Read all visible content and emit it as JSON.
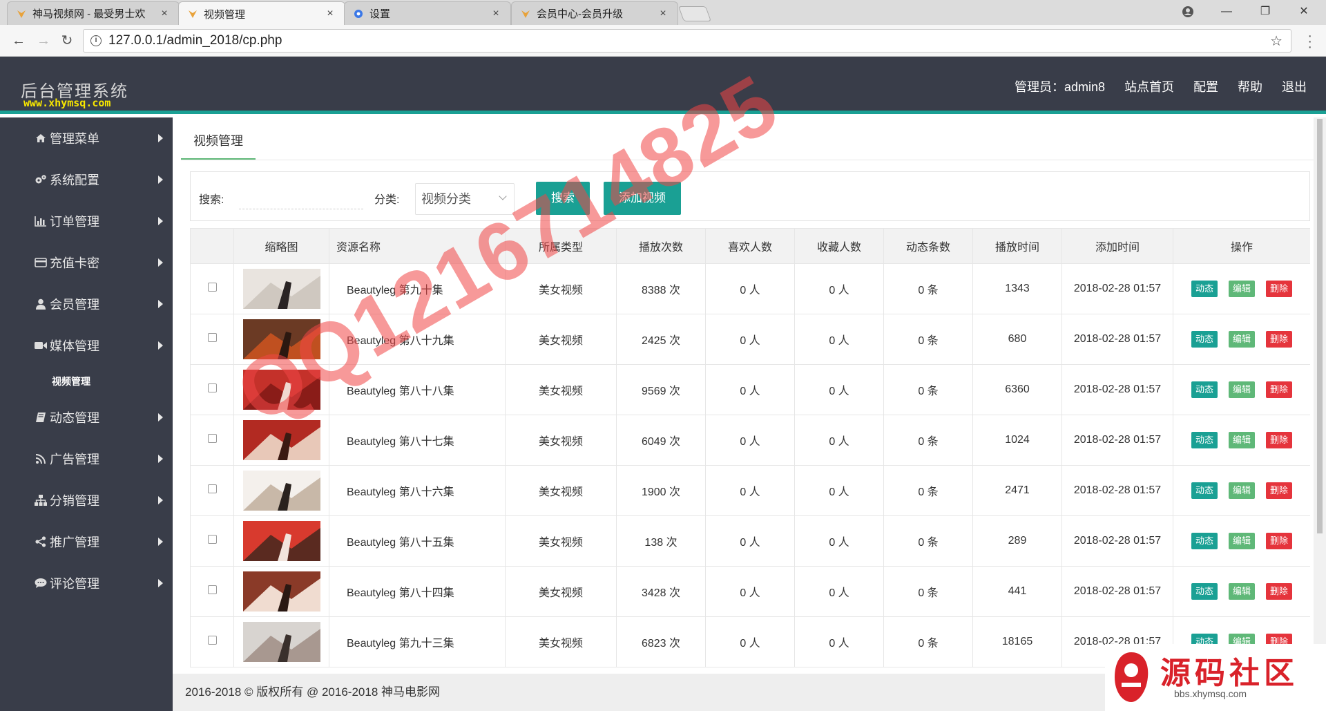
{
  "browser": {
    "tabs": [
      {
        "title": "神马视频网 - 最受男士欢",
        "active": false
      },
      {
        "title": "视频管理",
        "active": true
      },
      {
        "title": "设置",
        "active": false
      },
      {
        "title": "会员中心-会员升级",
        "active": false
      }
    ],
    "url": "127.0.0.1/admin_2018/cp.php",
    "close_glyph": "×"
  },
  "header": {
    "title": "后台管理系统",
    "site_url": "www.xhymsq.com",
    "nav": [
      "管理员：admin8",
      "站点首页",
      "配置",
      "帮助",
      "退出"
    ]
  },
  "sidebar": {
    "items": [
      {
        "label": "管理菜单",
        "icon": "home-icon"
      },
      {
        "label": "系统配置",
        "icon": "gears-icon"
      },
      {
        "label": "订单管理",
        "icon": "bar-chart-icon"
      },
      {
        "label": "充值卡密",
        "icon": "credit-card-icon"
      },
      {
        "label": "会员管理",
        "icon": "user-icon"
      },
      {
        "label": "媒体管理",
        "icon": "video-camera-icon"
      },
      {
        "label": "动态管理",
        "icon": "book-icon"
      },
      {
        "label": "广告管理",
        "icon": "rss-icon"
      },
      {
        "label": "分销管理",
        "icon": "sitemap-icon"
      },
      {
        "label": "推广管理",
        "icon": "share-icon"
      },
      {
        "label": "评论管理",
        "icon": "comment-icon"
      }
    ],
    "active_sub": "视频管理"
  },
  "main": {
    "page_tab": "视频管理",
    "search_label": "搜索:",
    "search_value": "",
    "category_label": "分类:",
    "category_selected": "视频分类",
    "search_button": "搜索",
    "add_button": "添加视频"
  },
  "table": {
    "headers": [
      "",
      "缩略图",
      "资源名称",
      "所属类型",
      "播放次数",
      "喜欢人数",
      "收藏人数",
      "动态条数",
      "播放时间",
      "添加时间",
      "操作"
    ],
    "actions": {
      "dynamic": "动态",
      "edit": "编辑",
      "delete": "删除"
    },
    "rows": [
      {
        "name": "Beautyleg 第九十集",
        "type": "美女视频",
        "plays": "8388 次",
        "likes": "0 人",
        "favs": "0 人",
        "posts": "0 条",
        "duration": "1343",
        "added": "2018-02-28 01:57"
      },
      {
        "name": "Beautyleg 第八十九集",
        "type": "美女视频",
        "plays": "2425 次",
        "likes": "0 人",
        "favs": "0 人",
        "posts": "0 条",
        "duration": "680",
        "added": "2018-02-28 01:57"
      },
      {
        "name": "Beautyleg 第八十八集",
        "type": "美女视频",
        "plays": "9569 次",
        "likes": "0 人",
        "favs": "0 人",
        "posts": "0 条",
        "duration": "6360",
        "added": "2018-02-28 01:57"
      },
      {
        "name": "Beautyleg 第八十七集",
        "type": "美女视频",
        "plays": "6049 次",
        "likes": "0 人",
        "favs": "0 人",
        "posts": "0 条",
        "duration": "1024",
        "added": "2018-02-28 01:57"
      },
      {
        "name": "Beautyleg 第八十六集",
        "type": "美女视频",
        "plays": "1900 次",
        "likes": "0 人",
        "favs": "0 人",
        "posts": "0 条",
        "duration": "2471",
        "added": "2018-02-28 01:57"
      },
      {
        "name": "Beautyleg 第八十五集",
        "type": "美女视频",
        "plays": "138 次",
        "likes": "0 人",
        "favs": "0 人",
        "posts": "0 条",
        "duration": "289",
        "added": "2018-02-28 01:57"
      },
      {
        "name": "Beautyleg 第八十四集",
        "type": "美女视频",
        "plays": "3428 次",
        "likes": "0 人",
        "favs": "0 人",
        "posts": "0 条",
        "duration": "441",
        "added": "2018-02-28 01:57"
      },
      {
        "name": "Beautyleg 第九十三集",
        "type": "美女视频",
        "plays": "6823 次",
        "likes": "0 人",
        "favs": "0 人",
        "posts": "0 条",
        "duration": "18165",
        "added": "2018-02-28 01:57"
      }
    ]
  },
  "footer": {
    "text": "2016-2018 © 版权所有 @ 2016-2018 神马电影网"
  },
  "watermark": {
    "text": "QQ1216714825"
  },
  "brand": {
    "title": "源码社区",
    "url": "bbs.xhymsq.com"
  },
  "colors": {
    "accent": "#1aa094",
    "edit": "#5fb878",
    "delete": "#e5343c",
    "header_bg": "#393d49",
    "watermark": "#f04646"
  }
}
